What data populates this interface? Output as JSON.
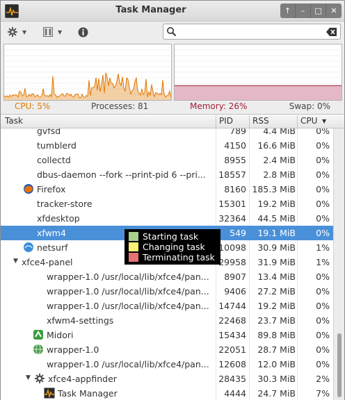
{
  "window": {
    "title": "Task Manager"
  },
  "window_buttons": [
    {
      "name": "up-arrow-icon",
      "glyph": "↑"
    },
    {
      "name": "minimize-icon",
      "glyph": "–"
    },
    {
      "name": "maximize-icon",
      "glyph": "□"
    },
    {
      "name": "close-icon",
      "glyph": "✕"
    }
  ],
  "toolbar": {
    "settings_icon": "gear-icon",
    "view_icon": "columns-icon",
    "info_icon": "info-icon",
    "search": {
      "value": "",
      "placeholder": ""
    }
  },
  "graphs": {
    "cpu_color": "#e07800",
    "mem_color": "#a11d36",
    "mem_fill": "#e4b8c6",
    "memory_fraction": 0.26
  },
  "status": {
    "cpu": "CPU: 5%",
    "processes": "Processes: 81",
    "memory": "Memory: 26%",
    "swap": "Swap: 0%"
  },
  "columns": {
    "task": "Task",
    "pid": "PID",
    "rss": "RSS",
    "cpu": "CPU",
    "sort_indicator": "▼"
  },
  "rows": [
    {
      "task": "gvfsd",
      "pid": "789",
      "rss": "4.4 MiB",
      "cpu": "0%",
      "depth": 1,
      "icon": ""
    },
    {
      "task": "tumblerd",
      "pid": "4150",
      "rss": "16.6 MiB",
      "cpu": "0%",
      "depth": 1,
      "icon": ""
    },
    {
      "task": "collectd",
      "pid": "8955",
      "rss": "2.4 MiB",
      "cpu": "0%",
      "depth": 1,
      "icon": ""
    },
    {
      "task": "dbus-daemon --fork --print-pid 6 --pri...",
      "pid": "18557",
      "rss": "2.8 MiB",
      "cpu": "0%",
      "depth": 1,
      "icon": ""
    },
    {
      "task": "Firefox",
      "pid": "8160",
      "rss": "185.3 MiB",
      "cpu": "0%",
      "depth": 1,
      "icon": "firefox-icon"
    },
    {
      "task": "tracker-store",
      "pid": "15301",
      "rss": "19.2 MiB",
      "cpu": "0%",
      "depth": 1,
      "icon": ""
    },
    {
      "task": "xfdesktop",
      "pid": "32364",
      "rss": "44.5 MiB",
      "cpu": "0%",
      "depth": 1,
      "icon": ""
    },
    {
      "task": "xfwm4",
      "pid": "549",
      "rss": "19.1 MiB",
      "cpu": "0%",
      "depth": 1,
      "icon": "",
      "selected": true
    },
    {
      "task": "netsurf",
      "pid": "10098",
      "rss": "30.9 MiB",
      "cpu": "1%",
      "depth": 0,
      "icon": "netsurf-icon"
    },
    {
      "task": "xfce4-panel",
      "pid": "29958",
      "rss": "31.9 MiB",
      "cpu": "1%",
      "depth": 0,
      "icon": "",
      "expanded": true
    },
    {
      "task": "wrapper-1.0 /usr/local/lib/xfce4/pan...",
      "pid": "8907",
      "rss": "13.4 MiB",
      "cpu": "0%",
      "depth": 2,
      "icon": ""
    },
    {
      "task": "wrapper-1.0 /usr/local/lib/xfce4/pan...",
      "pid": "9406",
      "rss": "27.2 MiB",
      "cpu": "0%",
      "depth": 2,
      "icon": ""
    },
    {
      "task": "wrapper-1.0 /usr/local/lib/xfce4/pan...",
      "pid": "14744",
      "rss": "19.2 MiB",
      "cpu": "0%",
      "depth": 2,
      "icon": ""
    },
    {
      "task": "xfwm4-settings",
      "pid": "22468",
      "rss": "23.7 MiB",
      "cpu": "0%",
      "depth": 2,
      "icon": ""
    },
    {
      "task": "Midori",
      "pid": "15434",
      "rss": "89.8 MiB",
      "cpu": "0%",
      "depth": 1,
      "icon": "midori-icon"
    },
    {
      "task": "wrapper-1.0",
      "pid": "22051",
      "rss": "28.7 MiB",
      "cpu": "0%",
      "depth": 1,
      "icon": "wrapper-globe-icon"
    },
    {
      "task": "wrapper-1.0 /usr/local/lib/xfce4/pan...",
      "pid": "12608",
      "rss": "12.0 MiB",
      "cpu": "0%",
      "depth": 2,
      "icon": ""
    },
    {
      "task": "xfce4-appfinder",
      "pid": "28435",
      "rss": "30.3 MiB",
      "cpu": "2%",
      "depth": 1,
      "icon": "gear-small-icon",
      "expanded": true
    },
    {
      "task": "Task Manager",
      "pid": "4444",
      "rss": "24.7 MiB",
      "cpu": "7%",
      "depth": 2,
      "icon": "task-manager-icon"
    }
  ],
  "legend": [
    {
      "label": "Starting task",
      "color": "#a8d08d"
    },
    {
      "label": "Changing task",
      "color": "#fff176"
    },
    {
      "label": "Terminating task",
      "color": "#e57373"
    }
  ],
  "scroll": {
    "position_fraction": 0.82
  }
}
